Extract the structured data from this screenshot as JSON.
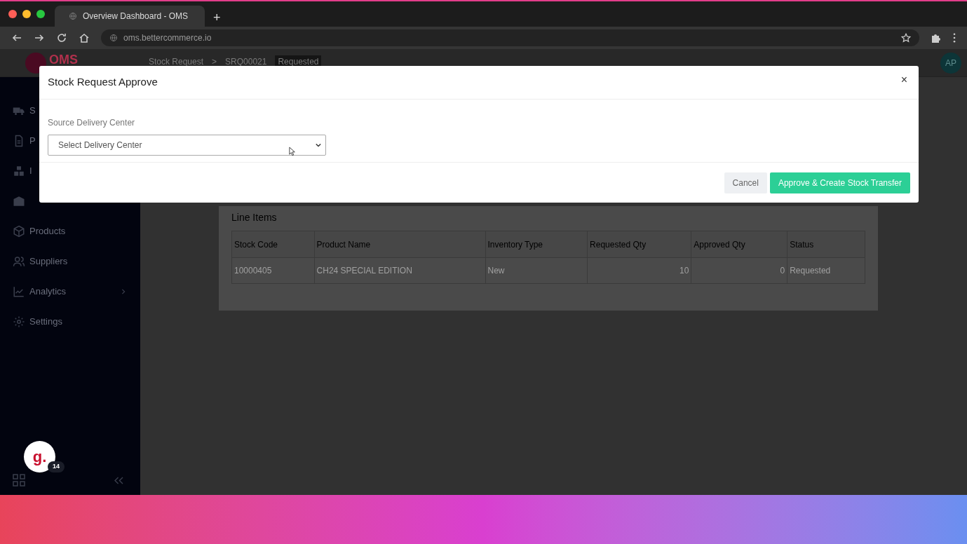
{
  "browser": {
    "tab_title": "Overview Dashboard - OMS",
    "new_tab": "+",
    "url": "oms.bettercommerce.io"
  },
  "header": {
    "logo": "OMS",
    "breadcrumb": [
      {
        "label": "Stock Request"
      },
      {
        "label": "SRQ00021"
      }
    ],
    "separator": ">",
    "status_badge": "Requested",
    "avatar": "AP"
  },
  "sidebar": {
    "items": [
      {
        "kind": "link",
        "label": "S"
      },
      {
        "kind": "link",
        "label": "P"
      },
      {
        "kind": "link",
        "label": "I"
      },
      {
        "kind": "link"
      },
      {
        "kind": "link",
        "label": "Products",
        "has_submenu": false
      },
      {
        "kind": "link",
        "label": "Suppliers",
        "has_submenu": false
      },
      {
        "kind": "link",
        "label": "Analytics",
        "has_submenu": true
      },
      {
        "kind": "link",
        "label": "Settings",
        "has_submenu": false
      }
    ]
  },
  "help_widget": {
    "letter": "g.",
    "count": "14"
  },
  "card": {
    "title": "Line Items",
    "columns": [
      "Stock Code",
      "Product Name",
      "Inventory Type",
      "Requested Qty",
      "Approved Qty",
      "Status"
    ],
    "rows": [
      [
        {
          "text": "10000405",
          "numeric": false
        },
        {
          "text": "CH24 SPECIAL EDITION",
          "numeric": false
        },
        {
          "text": "New",
          "numeric": false
        },
        {
          "text": "10",
          "numeric": true
        },
        {
          "text": "0",
          "numeric": true
        },
        {
          "text": "Requested",
          "numeric": false
        }
      ]
    ]
  },
  "modal": {
    "title": "Stock Request Approve",
    "close": "×",
    "field_label": "Source Delivery Center",
    "select_placeholder": "Select Delivery Center",
    "buttons": [
      {
        "label": "Cancel",
        "kind": "secondary"
      },
      {
        "label": "Approve & Create Stock Transfer",
        "kind": "primary"
      }
    ]
  }
}
